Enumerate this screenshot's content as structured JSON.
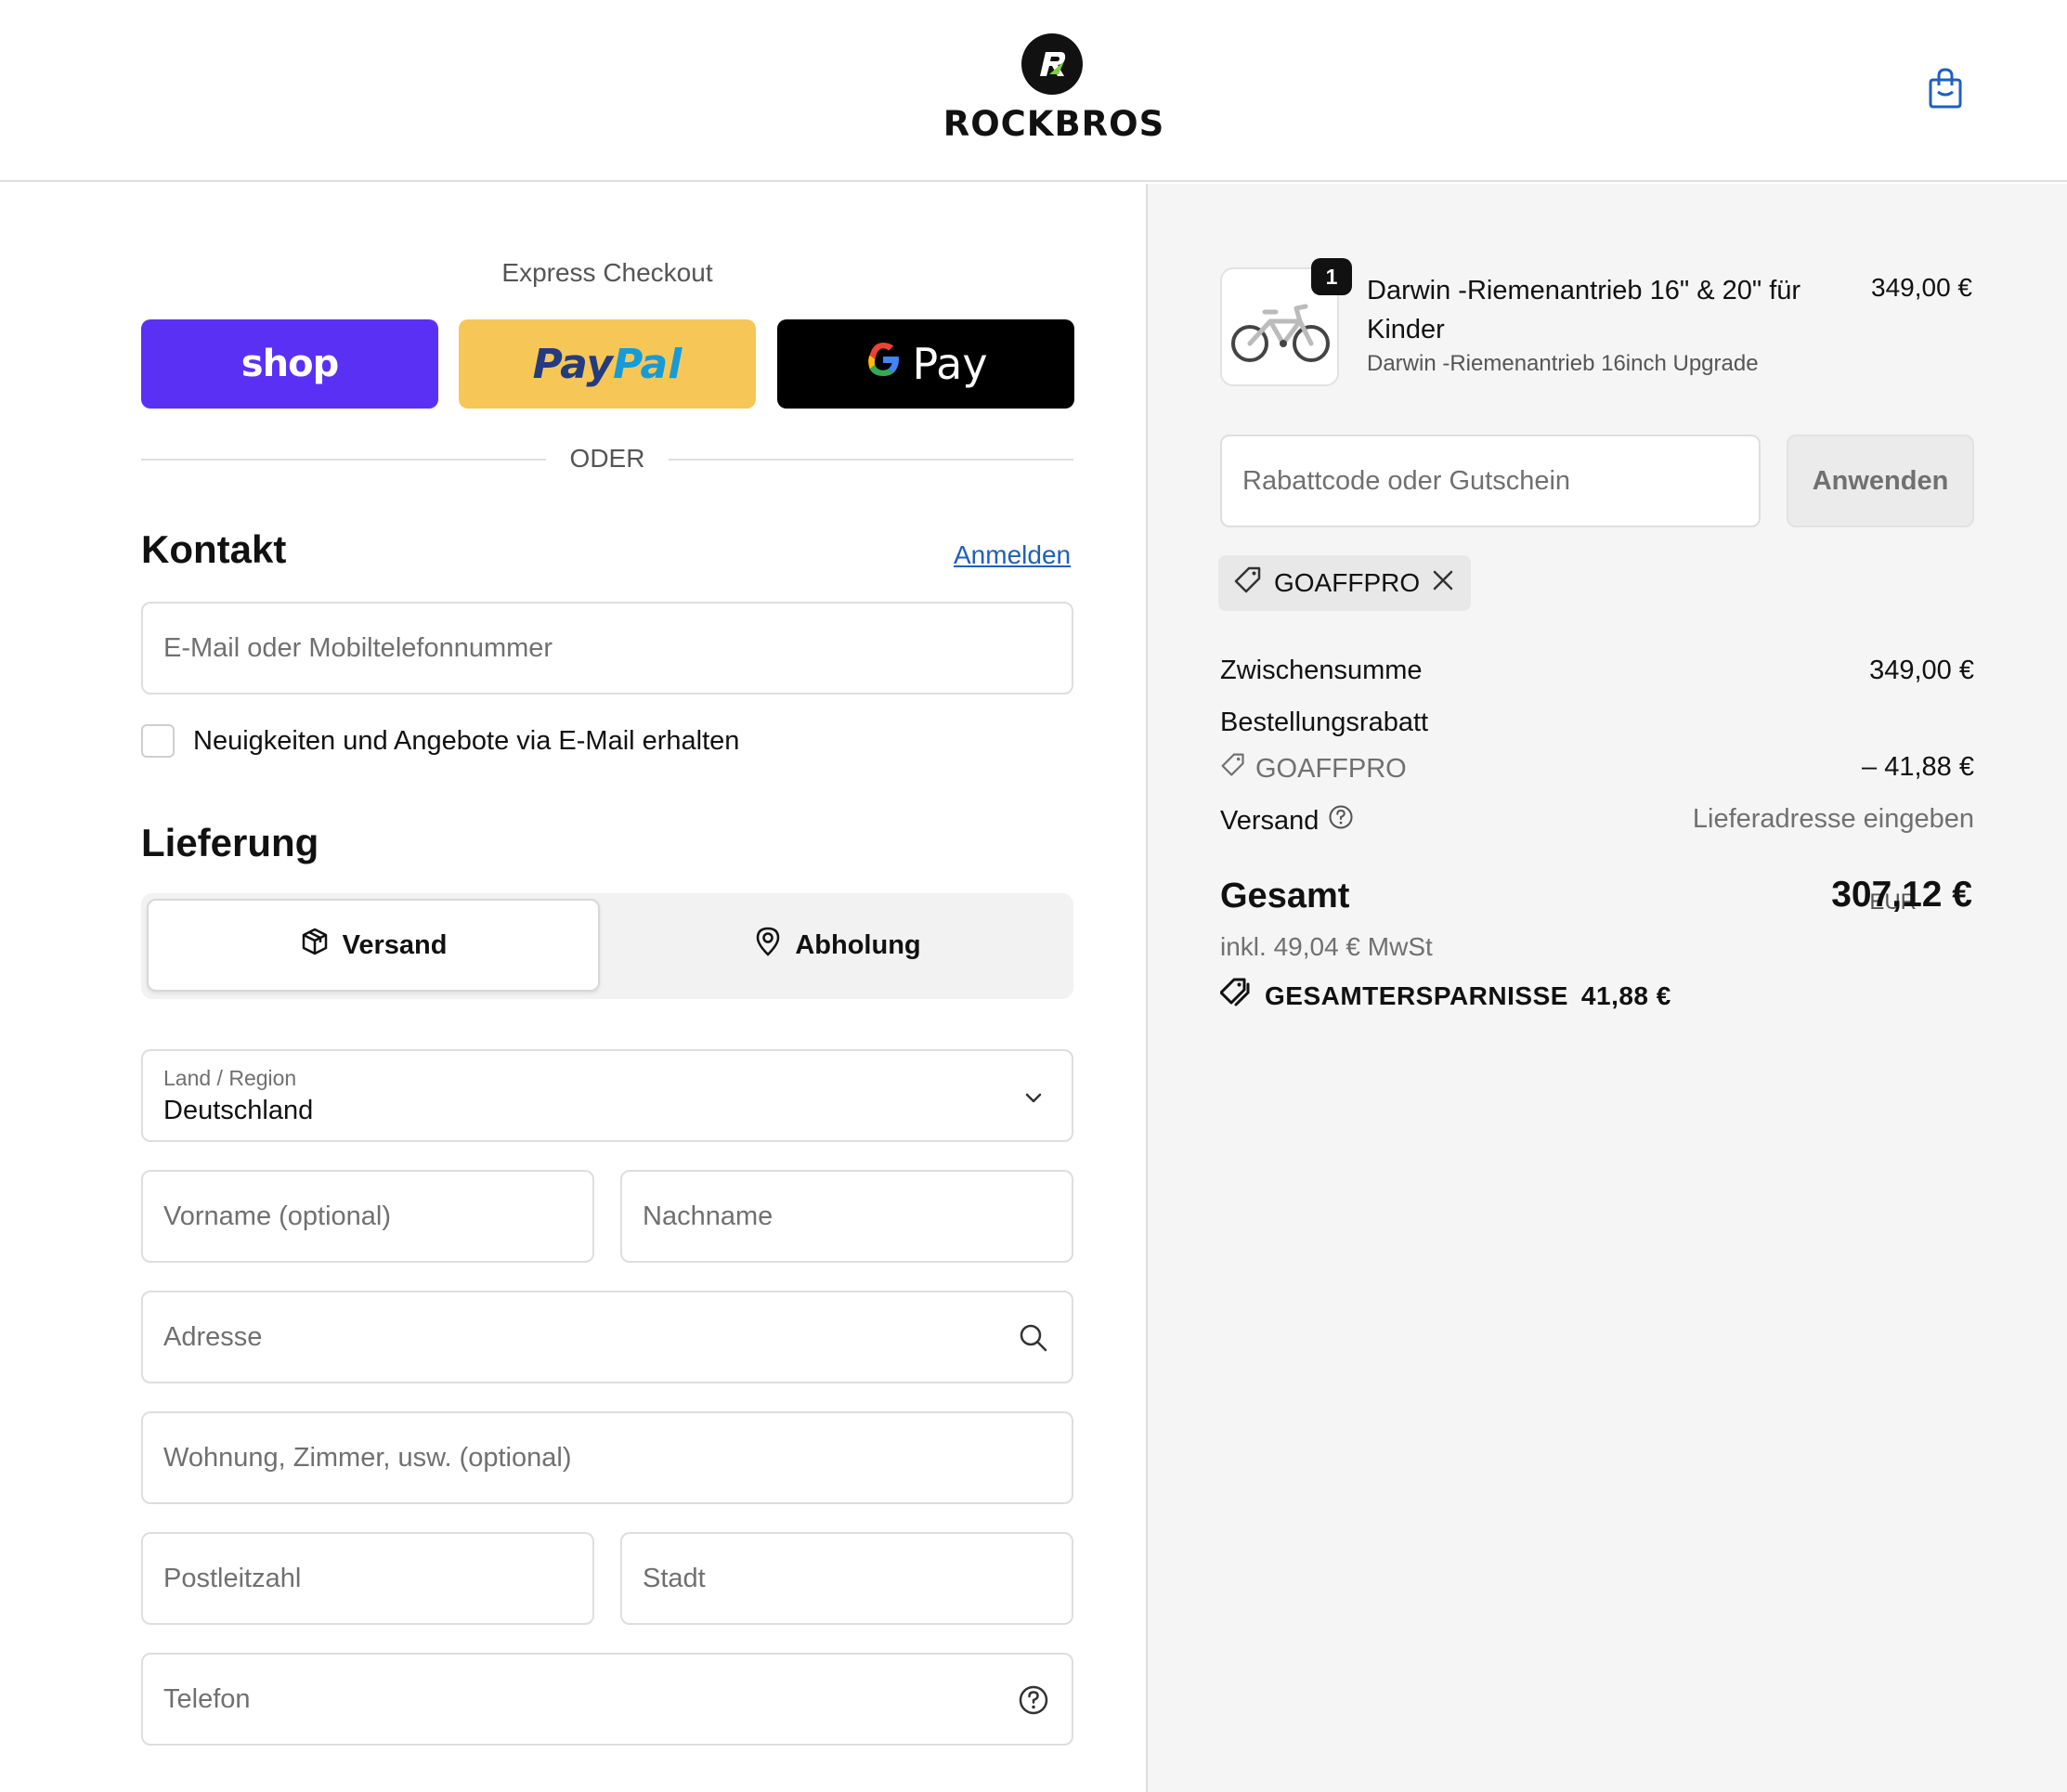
{
  "brand": {
    "name": "ROCKBROS"
  },
  "express": {
    "title": "Express Checkout",
    "shop_label": "shop",
    "paypal_label_a": "Pay",
    "paypal_label_b": "Pal",
    "gpay_label": "Pay",
    "divider": "ODER"
  },
  "contact": {
    "heading": "Kontakt",
    "login_link": "Anmelden",
    "email_placeholder": "E-Mail oder Mobiltelefonnummer",
    "newsletter_label": "Neuigkeiten und Angebote via E-Mail erhalten"
  },
  "delivery": {
    "heading": "Lieferung",
    "options": [
      {
        "label": "Versand",
        "icon": "package-icon",
        "selected": true
      },
      {
        "label": "Abholung",
        "icon": "location-pin-icon",
        "selected": false
      }
    ],
    "country_label": "Land / Region",
    "country_value": "Deutschland",
    "first_name_placeholder": "Vorname (optional)",
    "last_name_placeholder": "Nachname",
    "address_placeholder": "Adresse",
    "apartment_placeholder": "Wohnung, Zimmer, usw. (optional)",
    "zip_placeholder": "Postleitzahl",
    "city_placeholder": "Stadt",
    "phone_placeholder": "Telefon"
  },
  "summary": {
    "product": {
      "quantity": "1",
      "title": "Darwin -Riemenantrieb 16\" & 20\" für Kinder",
      "variant": "Darwin -Riemenantrieb 16inch Upgrade",
      "price": "349,00 €"
    },
    "discount_placeholder": "Rabattcode oder Gutschein",
    "apply_label": "Anwenden",
    "applied_code": "GOAFFPRO",
    "subtotal_label": "Zwischensumme",
    "subtotal_value": "349,00 €",
    "order_discount_label": "Bestellungsrabatt",
    "order_discount_code": "GOAFFPRO",
    "order_discount_value": "– 41,88 €",
    "shipping_label": "Versand",
    "shipping_value": "Lieferadresse eingeben",
    "total_label": "Gesamt",
    "total_currency": "EUR",
    "total_value": "307,12 €",
    "tax_note": "inkl. 49,04 € MwSt",
    "savings_label": "GESAMTERSPARNISSE",
    "savings_value": "41,88 €"
  },
  "colors": {
    "shop_pay": "#5a31f4",
    "paypal": "#f6c757",
    "gpay": "#000000",
    "link": "#1f5fbf",
    "sidebar_bg": "#f5f5f5"
  }
}
